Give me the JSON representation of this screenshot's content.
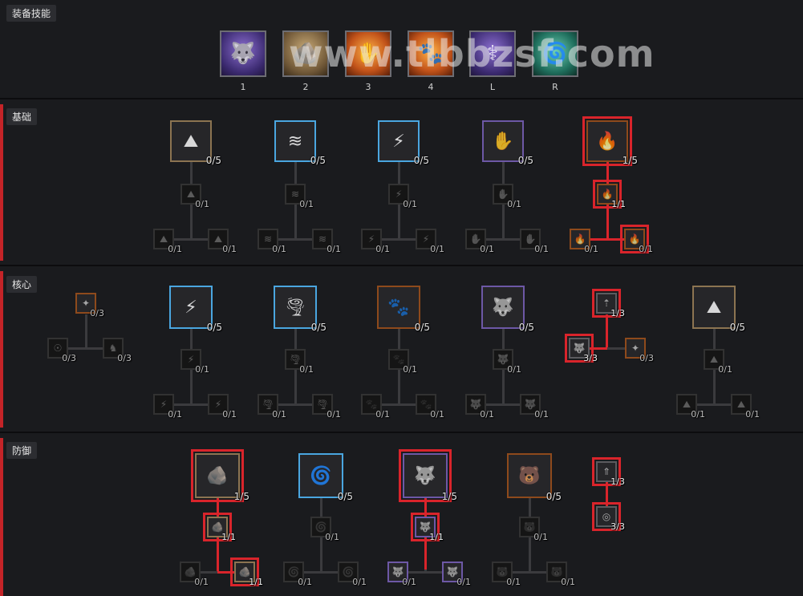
{
  "watermark": "www.tlbbzsf.com",
  "equipped": {
    "title": "装备技能",
    "slots": [
      {
        "key": "1",
        "icon": "werewolf-howl-icon",
        "glyph": "🐺",
        "color": "purple"
      },
      {
        "key": "2",
        "icon": "boulder-icon",
        "glyph": "🪨",
        "color": "tan"
      },
      {
        "key": "3",
        "icon": "feral-claw-icon",
        "glyph": "✋",
        "color": "orange"
      },
      {
        "key": "4",
        "icon": "werebear-claw-icon",
        "glyph": "🐾",
        "color": "orange"
      },
      {
        "key": "L",
        "icon": "werewolf-bite-icon",
        "glyph": "⚕",
        "color": "purple"
      },
      {
        "key": "R",
        "icon": "cyclone-icon",
        "glyph": "🌀",
        "color": "teal"
      }
    ]
  },
  "sections": {
    "basic": "基础",
    "core": "核心",
    "defense": "防御"
  },
  "basic_trees": [
    {
      "main": {
        "count": "0/5",
        "icon": "earth-spike-icon",
        "glyph": "⛰",
        "color": "stone"
      },
      "mod": {
        "count": "0/1",
        "glyph": "⛰"
      },
      "left": {
        "count": "0/1",
        "glyph": "⛰"
      },
      "right": {
        "count": "0/1",
        "glyph": "⛰"
      }
    },
    {
      "main": {
        "count": "0/5",
        "icon": "wind-shear-icon",
        "glyph": "≋",
        "color": "blue"
      },
      "mod": {
        "count": "0/1",
        "glyph": "≋"
      },
      "left": {
        "count": "0/1",
        "glyph": "≋"
      },
      "right": {
        "count": "0/1",
        "glyph": "≋"
      }
    },
    {
      "main": {
        "count": "0/5",
        "icon": "storm-strike-icon",
        "glyph": "⚡",
        "color": "blue"
      },
      "mod": {
        "count": "0/1",
        "glyph": "⚡"
      },
      "left": {
        "count": "0/1",
        "glyph": "⚡"
      },
      "right": {
        "count": "0/1",
        "glyph": "⚡"
      }
    },
    {
      "main": {
        "count": "0/5",
        "icon": "claw-icon",
        "glyph": "✋",
        "color": "violet"
      },
      "mod": {
        "count": "0/1",
        "glyph": "✋"
      },
      "left": {
        "count": "0/1",
        "glyph": "✋"
      },
      "right": {
        "count": "0/1",
        "glyph": "✋"
      }
    },
    {
      "main": {
        "count": "1/5",
        "icon": "maul-icon",
        "glyph": "🔥",
        "color": "amber"
      },
      "mod": {
        "count": "1/1",
        "glyph": "🔥",
        "color": "amber"
      },
      "left": {
        "count": "0/1",
        "glyph": "🔥",
        "color": "amber"
      },
      "right": {
        "count": "0/1",
        "glyph": "🔥",
        "color": "amber"
      }
    }
  ],
  "core_trees": [
    {
      "main": {
        "count": "0/5",
        "icon": "lightning-storm-icon",
        "glyph": "⚡",
        "color": "blue"
      },
      "mod": {
        "count": "0/1",
        "glyph": "⚡"
      },
      "left": {
        "count": "0/1",
        "glyph": "⚡"
      },
      "right": {
        "count": "0/1",
        "glyph": "⚡"
      }
    },
    {
      "main": {
        "count": "0/5",
        "icon": "tornado-icon",
        "glyph": "🌪",
        "color": "blue"
      },
      "mod": {
        "count": "0/1",
        "glyph": "🌪"
      },
      "left": {
        "count": "0/1",
        "glyph": "🌪"
      },
      "right": {
        "count": "0/1",
        "glyph": "🌪"
      }
    },
    {
      "main": {
        "count": "0/5",
        "icon": "pulverize-icon",
        "glyph": "🐾",
        "color": "orange"
      },
      "mod": {
        "count": "0/1",
        "glyph": "🐾"
      },
      "left": {
        "count": "0/1",
        "glyph": "🐾"
      },
      "right": {
        "count": "0/1",
        "glyph": "🐾"
      }
    },
    {
      "main": {
        "count": "0/5",
        "icon": "shred-icon",
        "glyph": "🐺",
        "color": "violet"
      },
      "mod": {
        "count": "0/1",
        "glyph": "🐺"
      },
      "left": {
        "count": "0/1",
        "glyph": "🐺"
      },
      "right": {
        "count": "0/1",
        "glyph": "🐺"
      }
    },
    {
      "main": {
        "count": "0/5",
        "icon": "landslide-icon",
        "glyph": "⛰",
        "color": "gold"
      },
      "mod": {
        "count": "0/1",
        "glyph": "⛰"
      },
      "left": {
        "count": "0/1",
        "glyph": "⛰"
      },
      "right": {
        "count": "0/1",
        "glyph": "⛰"
      }
    }
  ],
  "core_passives": {
    "left_top": {
      "count": "0/3",
      "glyph": "✦"
    },
    "left_a": {
      "count": "0/3",
      "glyph": "☉"
    },
    "left_b": {
      "count": "0/3",
      "glyph": "♞"
    },
    "right_top": {
      "count": "1/3",
      "glyph": "⇡"
    },
    "right_a": {
      "count": "3/3",
      "glyph": "🐺"
    },
    "right_b": {
      "count": "0/3",
      "glyph": "✦"
    }
  },
  "defense_trees": [
    {
      "main": {
        "count": "1/5",
        "icon": "earthen-bulwark-icon",
        "glyph": "🪨",
        "color": "stone"
      },
      "mod": {
        "count": "1/1",
        "glyph": "🪨",
        "color": "stone"
      },
      "left": {
        "count": "0/1",
        "glyph": "🪨"
      },
      "right": {
        "count": "1/1",
        "glyph": "🪨",
        "color": "stone"
      }
    },
    {
      "main": {
        "count": "0/5",
        "icon": "cyclone-armor-icon",
        "glyph": "🌀",
        "color": "blue"
      },
      "mod": {
        "count": "0/1",
        "glyph": "🌀"
      },
      "left": {
        "count": "0/1",
        "glyph": "🌀"
      },
      "right": {
        "count": "0/1",
        "glyph": "🌀"
      }
    },
    {
      "main": {
        "count": "1/5",
        "icon": "blood-howl-icon",
        "glyph": "🐺",
        "color": "violet"
      },
      "mod": {
        "count": "1/1",
        "glyph": "🐺",
        "color": "violet"
      },
      "left": {
        "count": "0/1",
        "glyph": "🐺",
        "color": "violet"
      },
      "right": {
        "count": "0/1",
        "glyph": "🐺",
        "color": "violet"
      }
    },
    {
      "main": {
        "count": "0/5",
        "icon": "debilitating-roar-icon",
        "glyph": "🐻",
        "color": "amber"
      },
      "mod": {
        "count": "0/1",
        "glyph": "🐻"
      },
      "left": {
        "count": "0/1",
        "glyph": "🐻"
      },
      "right": {
        "count": "0/1",
        "glyph": "🐻"
      }
    }
  ],
  "defense_passives": {
    "top": {
      "count": "1/3",
      "glyph": "⇑"
    },
    "bottom": {
      "count": "3/3",
      "glyph": "◎"
    }
  }
}
